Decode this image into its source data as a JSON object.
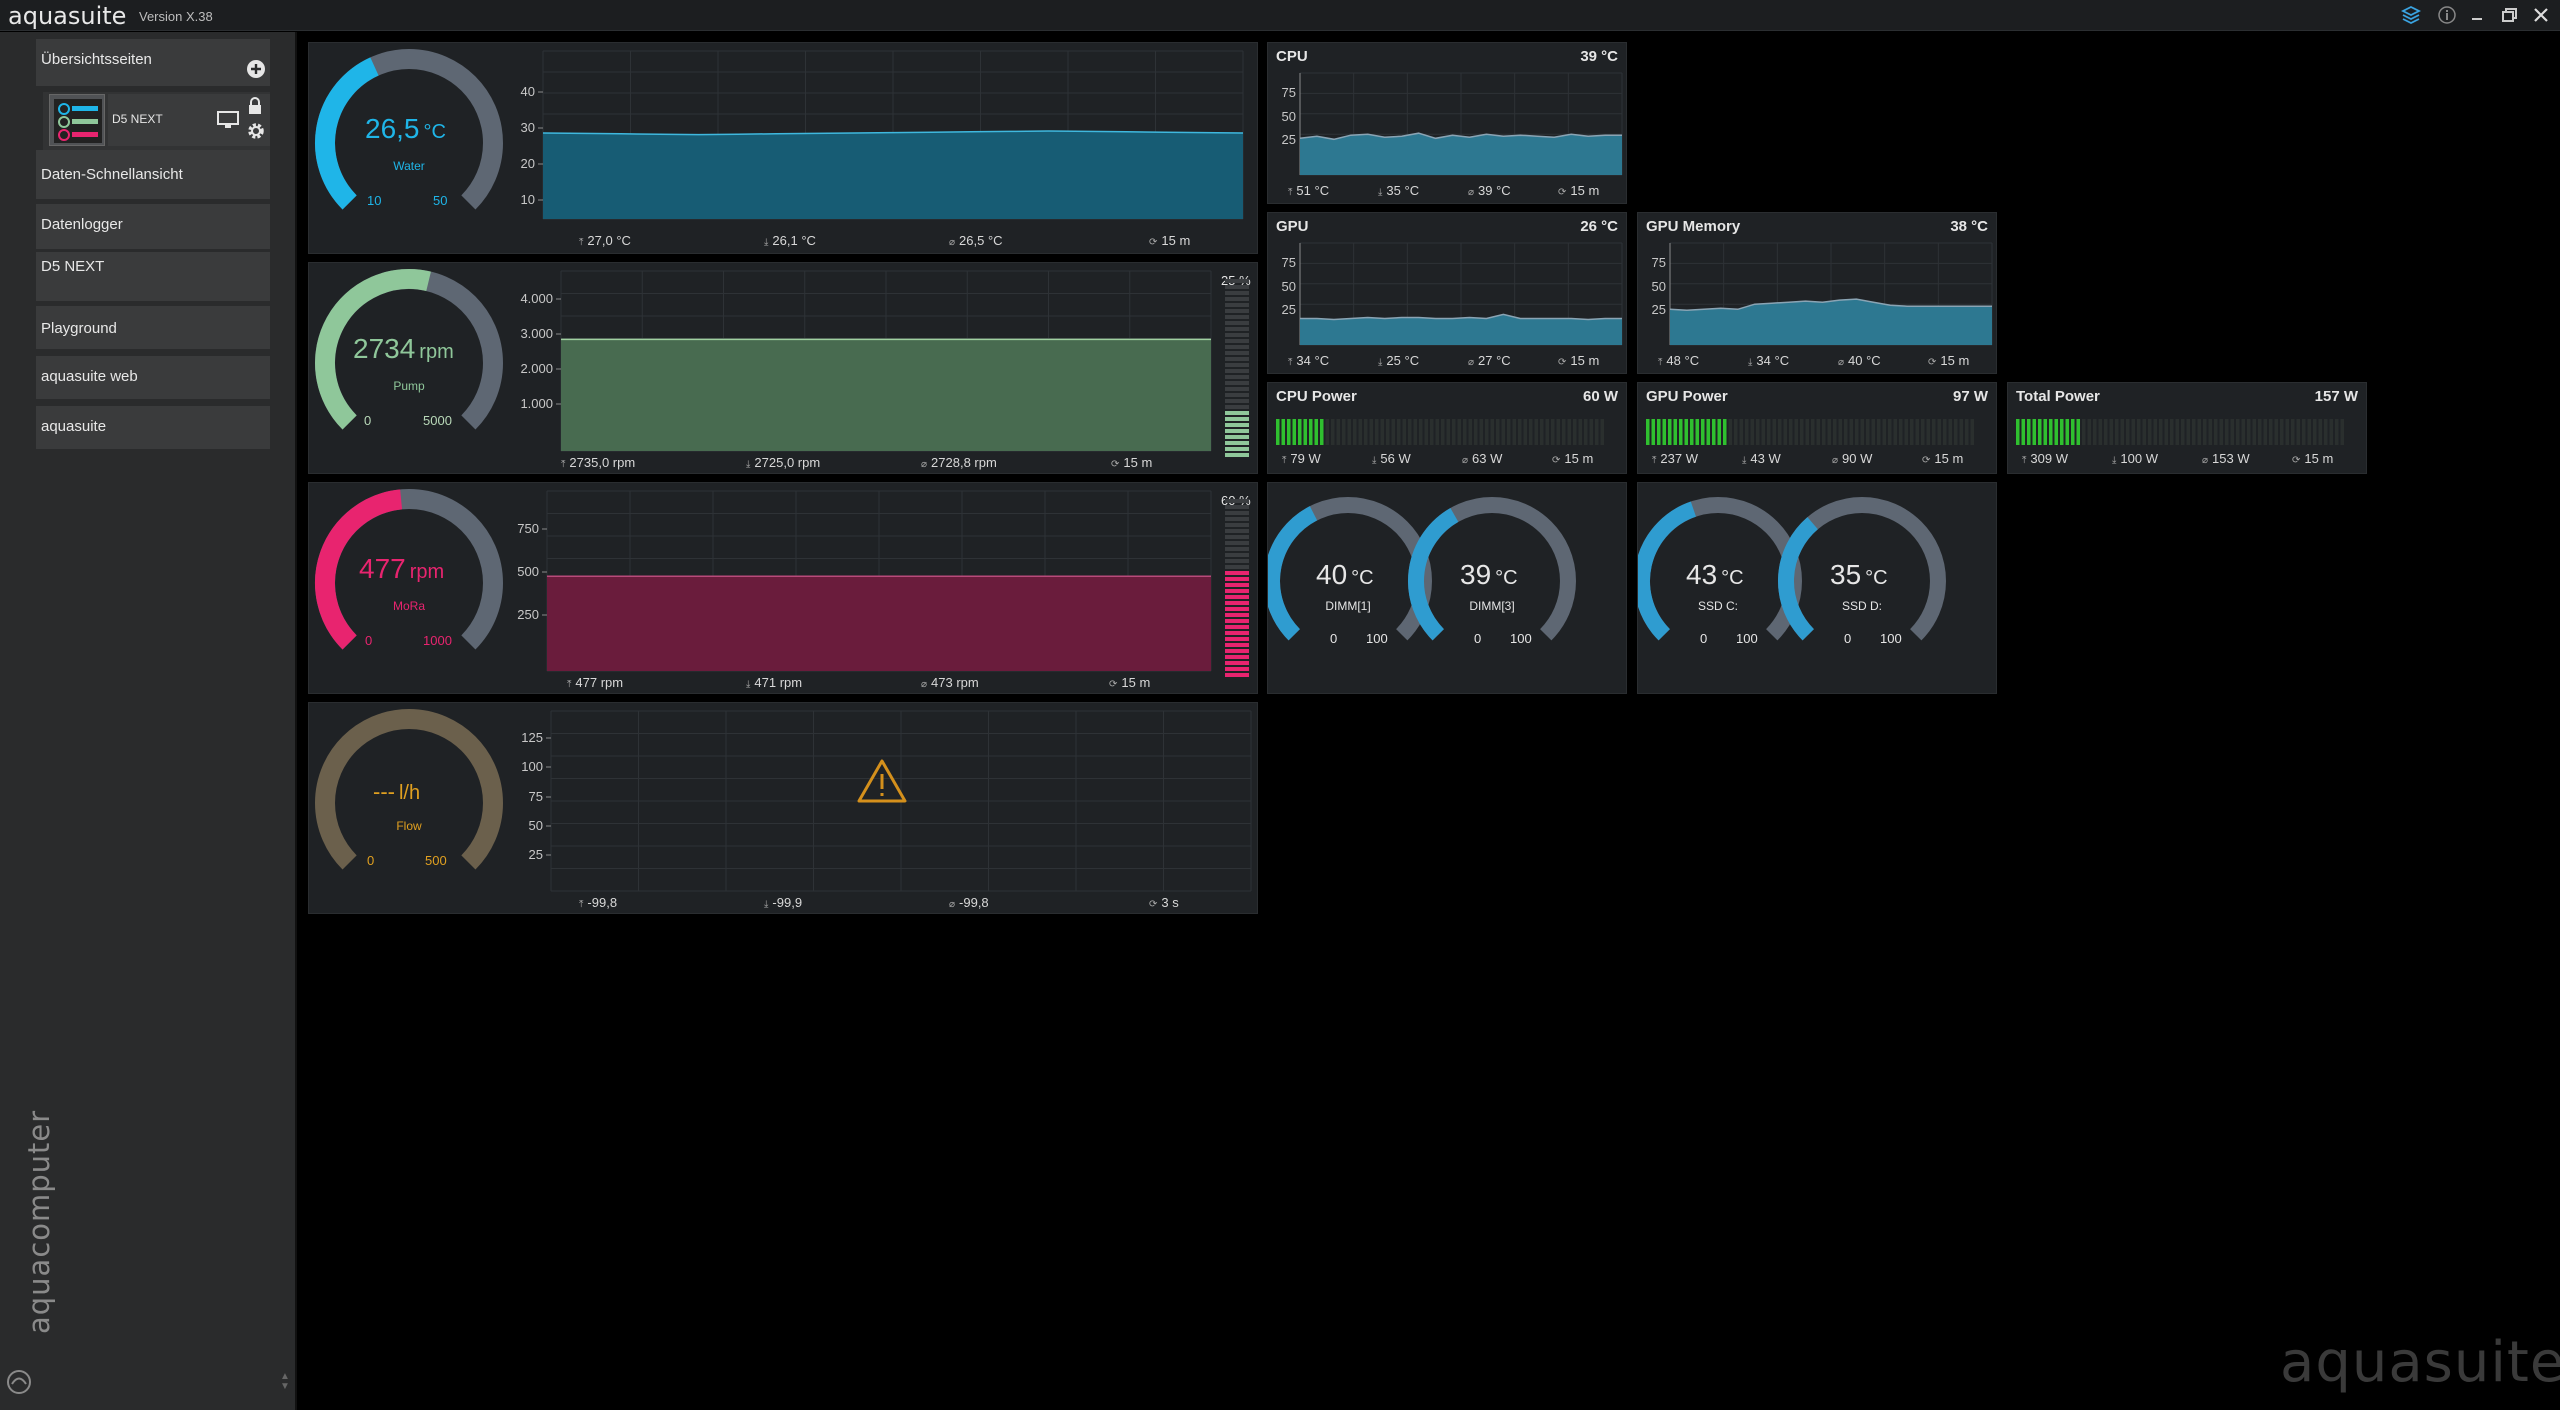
{
  "titlebar": {
    "app_name": "aquasuite",
    "version": "Version X.38"
  },
  "sidebar": {
    "overview_pages": "Übersichtsseiten",
    "page_thumb": "D5 NEXT",
    "items": [
      "Daten-Schnellansicht",
      "Datenlogger",
      "D5 NEXT",
      "Playground",
      "aquasuite web",
      "aquasuite"
    ],
    "brand": "aquacomputer"
  },
  "watermark": "aquasuite",
  "panels": {
    "water": {
      "value": "26,5",
      "unit": "°C",
      "label": "Water",
      "min": "10",
      "max": "50",
      "stats": [
        "27,0 °C",
        "26,1 °C",
        "26,5 °C",
        "15 m"
      ],
      "ticks": [
        "40",
        "30",
        "20",
        "10"
      ],
      "color": "#1fb5e8"
    },
    "pump": {
      "value": "2734",
      "unit": "rpm",
      "label": "Pump",
      "min": "0",
      "max": "5000",
      "stats": [
        "2735,0 rpm",
        "2725,0 rpm",
        "2728,8 rpm",
        "15 m"
      ],
      "ticks": [
        "4.000",
        "3.000",
        "2.000",
        "1.000"
      ],
      "pct": "25 %",
      "color": "#8fc79a"
    },
    "mora": {
      "value": "477",
      "unit": "rpm",
      "label": "MoRa",
      "min": "0",
      "max": "1000",
      "stats": [
        "477 rpm",
        "471 rpm",
        "473 rpm",
        "15 m"
      ],
      "ticks": [
        "750",
        "500",
        "250"
      ],
      "pct": "60 %",
      "color": "#e8246f"
    },
    "flow": {
      "value": "---",
      "unit": "l/h",
      "label": "Flow",
      "min": "0",
      "max": "500",
      "stats": [
        "-99,8",
        "-99,9",
        "-99,8",
        "3 s"
      ],
      "ticks": [
        "125",
        "100",
        "75",
        "50",
        "25"
      ],
      "color": "#e0a020"
    }
  },
  "tiles": {
    "cpu": {
      "title": "CPU",
      "value": "39 °C",
      "ticks": [
        "75",
        "50",
        "25"
      ],
      "stats": [
        "51 °C",
        "35 °C",
        "39 °C",
        "15 m"
      ]
    },
    "gpu": {
      "title": "GPU",
      "value": "26 °C",
      "ticks": [
        "75",
        "50",
        "25"
      ],
      "stats": [
        "34 °C",
        "25 °C",
        "27 °C",
        "15 m"
      ]
    },
    "gpu_mem": {
      "title": "GPU Memory",
      "value": "38 °C",
      "ticks": [
        "75",
        "50",
        "25"
      ],
      "stats": [
        "48 °C",
        "34 °C",
        "40 °C",
        "15 m"
      ]
    },
    "cpu_power": {
      "title": "CPU Power",
      "value": "60 W",
      "stats": [
        "79 W",
        "56 W",
        "63 W",
        "15 m"
      ],
      "level": 0.15
    },
    "gpu_power": {
      "title": "GPU Power",
      "value": "97 W",
      "stats": [
        "237 W",
        "43 W",
        "90 W",
        "15 m"
      ],
      "level": 0.25
    },
    "total_power": {
      "title": "Total Power",
      "value": "157 W",
      "stats": [
        "309 W",
        "100 W",
        "153 W",
        "15 m"
      ],
      "level": 0.2
    }
  },
  "small_gauges": [
    {
      "value": "40",
      "unit": "°C",
      "label": "DIMM[1]",
      "min": "0",
      "max": "100",
      "level": 0.4
    },
    {
      "value": "39",
      "unit": "°C",
      "label": "DIMM[3]",
      "min": "0",
      "max": "100",
      "level": 0.39
    },
    {
      "value": "43",
      "unit": "°C",
      "label": "SSD C:",
      "min": "0",
      "max": "100",
      "level": 0.43
    },
    {
      "value": "35",
      "unit": "°C",
      "label": "SSD D:",
      "min": "0",
      "max": "100",
      "level": 0.35
    }
  ],
  "colors": {
    "accent_blue": "#1fb5e8",
    "bar_green": "#2fc02f",
    "gauge_grey": "#5e6773"
  }
}
